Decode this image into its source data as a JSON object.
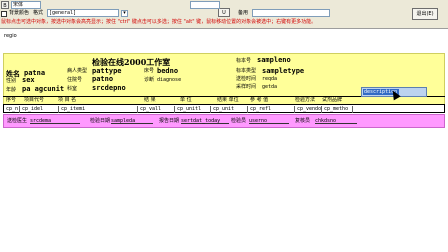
{
  "toolbar": {
    "top_label_1": "B",
    "top_label_2": "宋体",
    "bg_color_check_label": "背景颜色",
    "format_label": "格式",
    "format_value": "[general]",
    "small_label": "U",
    "remark_label": "备用",
    "exit_label": "退出(E)",
    "hint_text": "鼠标点击可选中对象，按选中对象会高亮显示；按住 \"ctrl\" 键点击可以多选；按住 \"alt\" 键，鼠标移动位置的对象会被选中；右键有更多功能。"
  },
  "canvas": {
    "corner_label": "regio",
    "report_title": "检验在线2000工作室",
    "sample_no_label": "标本号",
    "sample_no_value": "samplenо",
    "row1": {
      "name_label": "姓名",
      "name_value": "patna",
      "pattype_label": "病人类型",
      "pattype_value": "pattype",
      "bed_label": "床号",
      "bed_value": "bedno",
      "sampletype_label": "标本类型",
      "sampletype_value": "sampletype"
    },
    "row2": {
      "sex_label": "性别",
      "sex_value": "sex",
      "dept_label": "住院号",
      "dept_value": "patno",
      "diag_label": "诊断",
      "diag_value": "diagnose",
      "reqdoc_label": "送检时间",
      "reqdoc_value": "reqda"
    },
    "row3": {
      "age_label": "年龄",
      "age_value": "pa agcunit",
      "section_label": "科室",
      "section_value": "srcdepno",
      "getdate_label": "采样时间",
      "getdate_value": "getda"
    },
    "columns": [
      "序号",
      "项目代号",
      "项  目  名",
      "结    果",
      "单    位",
      "结果 单位",
      "参  考  值",
      "检验方法",
      "试剂品牌"
    ],
    "row_values": [
      "cp_n",
      "cp_idel",
      "cp_itemi",
      "cp_vall",
      "cp_unitl",
      "cp_unit",
      "cp_refl",
      "cp_vendo",
      "cp_metho"
    ],
    "footer": {
      "sender_label": "送检医生",
      "sender_value": "srcdema",
      "sample_date_label": "检验日期",
      "sample_date_value": "sampleda",
      "report_date_label": "报告日期",
      "report_date_value": "sertdat_today",
      "checker_label": "检验员",
      "checker_value": "userno",
      "reviewer_label": "复核员",
      "reviewer_value": "chkdsno"
    },
    "desc_box_value": "description"
  }
}
